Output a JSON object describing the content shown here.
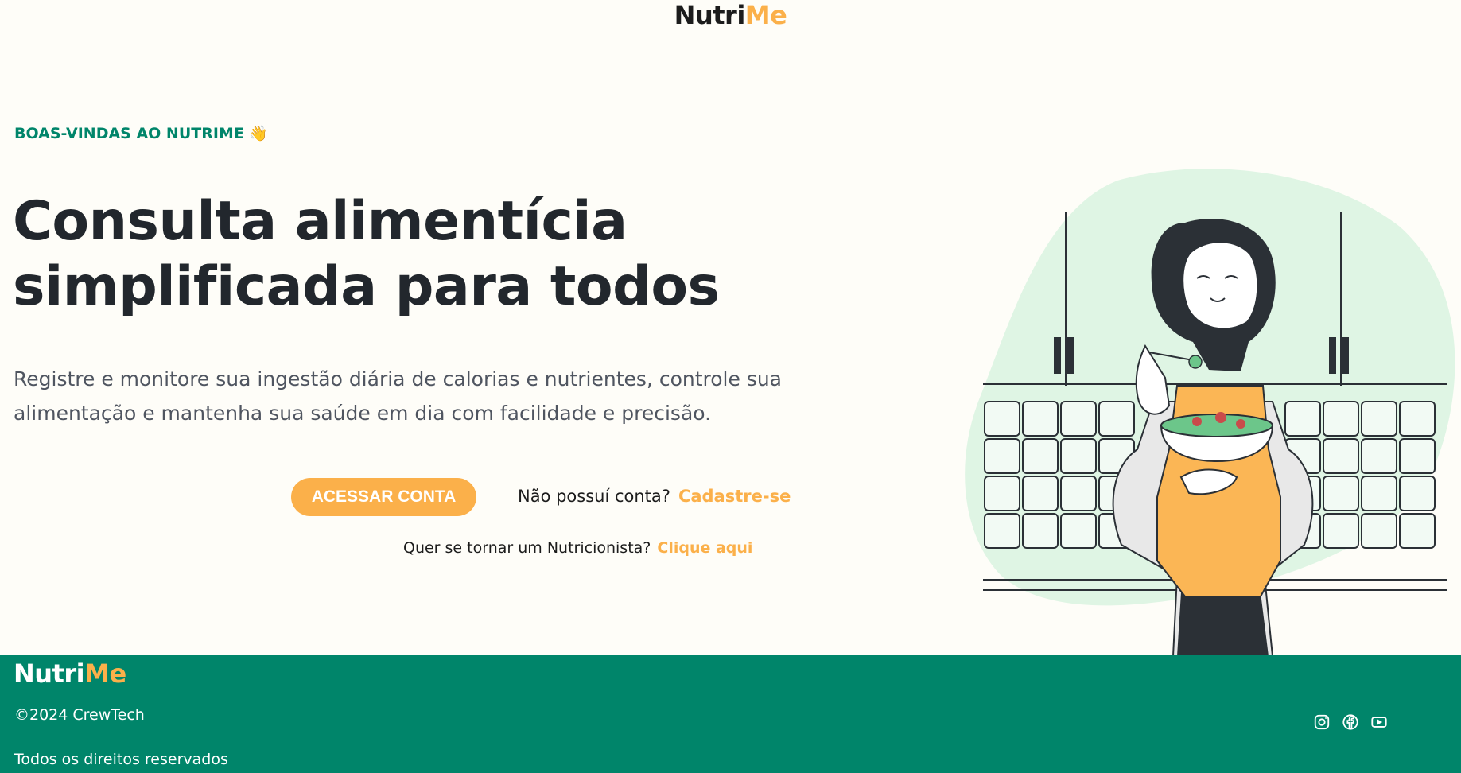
{
  "header": {
    "logo_main": "Nutri",
    "logo_accent": "Me"
  },
  "hero": {
    "welcome": "BOAS-VINDAS AO NUTRIME 👋",
    "title_line1": "Consulta alimentícia",
    "title_line2": "simplificada para todos",
    "description": "Registre e monitore sua ingestão diária de calorias e nutrientes, controle sua alimentação e mantenha sua saúde em dia com facilidade e precisão.",
    "login_button": "ACESSAR CONTA",
    "no_account_text": "Não possuí conta?",
    "signup_link": "Cadastre-se",
    "nutritionist_text": "Quer se tornar um Nutricionista?",
    "nutritionist_link": "Clique aqui"
  },
  "footer": {
    "logo_main": "Nutri",
    "logo_accent": "Me",
    "copyright": "©2024 CrewTech",
    "rights": "Todos os direitos reservados",
    "socials": [
      "instagram-icon",
      "facebook-icon",
      "youtube-icon"
    ]
  },
  "colors": {
    "background": "#fefdf8",
    "accent": "#fbb04a",
    "brand_green": "#00856a",
    "text_dark": "#22272d"
  }
}
